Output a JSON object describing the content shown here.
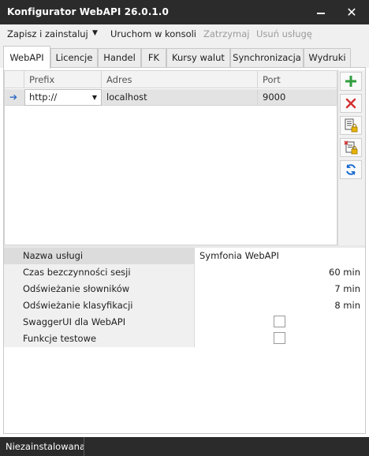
{
  "window": {
    "title": "Konfigurator WebAPI 26.0.1.0"
  },
  "menu": {
    "install_label": "Zapisz i zainstaluj",
    "run_label": "Uruchom w konsoli",
    "stop_label": "Zatrzymaj",
    "remove_label": "Usuń usługę"
  },
  "tabs": [
    "WebAPI",
    "Licencje",
    "Handel",
    "FK",
    "Kursy walut",
    "Synchronizacja",
    "Wydruki"
  ],
  "active_tab": "WebAPI",
  "grid": {
    "columns": [
      "Prefix",
      "Adres",
      "Port"
    ],
    "rows": [
      {
        "prefix": "http://",
        "address": "localhost",
        "port": "9000"
      }
    ]
  },
  "toolbar_icons": [
    "add-icon",
    "delete-icon",
    "document-lock-icon",
    "document-delete-lock-icon",
    "refresh-icon"
  ],
  "properties": [
    {
      "name": "Nazwa usługi",
      "value": "Symfonia WebAPI"
    },
    {
      "name": "Czas bezczynności sesji",
      "value": "60 min"
    },
    {
      "name": "Odświeżanie słowników",
      "value": "7 min"
    },
    {
      "name": "Odświeżanie klasyfikacji",
      "value": "8 min"
    },
    {
      "name": "SwaggerUI dla WebAPI",
      "checked": false
    },
    {
      "name": "Funkcje testowe",
      "checked": false
    }
  ],
  "status": {
    "text": "Niezainstalowana"
  },
  "colors": {
    "titlebar": "#2b2b2b",
    "add_green": "#2e9e3e",
    "delete_red": "#d32f2f",
    "refresh_blue": "#1f6fd1"
  }
}
